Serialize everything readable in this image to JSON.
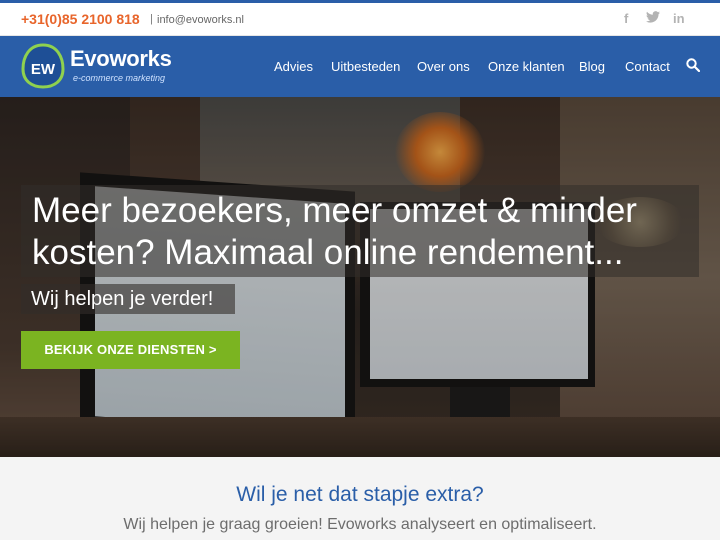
{
  "topbar": {
    "phone": "+31(0)85 2100 818",
    "separator": "|",
    "email": "info@evoworks.nl",
    "social": [
      {
        "icon": "facebook-icon",
        "glyph": "f"
      },
      {
        "icon": "twitter-icon",
        "glyph": "🐦"
      },
      {
        "icon": "linkedin-icon",
        "glyph": "in"
      }
    ]
  },
  "header": {
    "brand": "Evoworks",
    "tagline": "e-commerce marketing",
    "logo_text": "EW",
    "nav": [
      "Advies",
      "Uitbesteden",
      "Over ons",
      "Onze klanten",
      "Blog",
      "Contact"
    ],
    "search_icon": "search-icon"
  },
  "hero": {
    "headline": "Meer bezoekers, meer omzet & minder kosten? Maximaal online rendement...",
    "subline": "Wij helpen je verder!",
    "cta": "BEKIJK ONZE DIENSTEN >"
  },
  "section": {
    "title": "Wil je net dat stapje extra?",
    "text": "Wij helpen je graag groeien! Evoworks analyseert en optimaliseert."
  },
  "colors": {
    "brand_blue": "#2a5ea8",
    "accent_orange": "#e8652b",
    "cta_green": "#7bb421",
    "logo_green": "#8fd14f"
  }
}
